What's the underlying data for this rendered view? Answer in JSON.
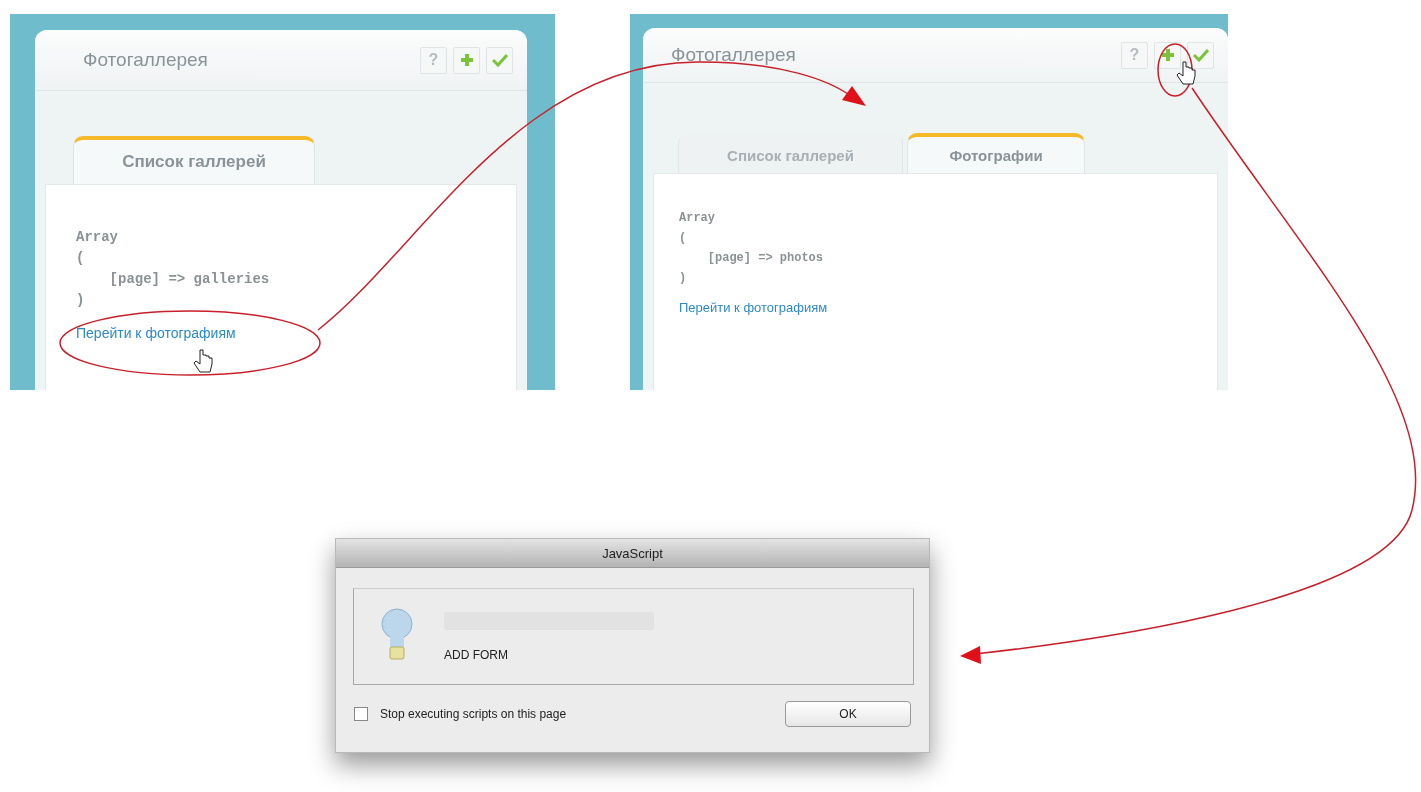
{
  "panels": [
    {
      "title": "Фотогаллерея",
      "buttons": [
        {
          "kind": "help",
          "label": "?"
        },
        {
          "kind": "add"
        },
        {
          "kind": "ok"
        }
      ],
      "tabs": [
        {
          "label": "Список галлерей",
          "selected": true
        }
      ],
      "code_lines": [
        "Array",
        "(",
        "    [page] => galleries",
        ")"
      ],
      "link": "Перейти к фотографиям"
    },
    {
      "title": "Фотогаллерея",
      "buttons": [
        {
          "kind": "help",
          "label": "?"
        },
        {
          "kind": "add"
        },
        {
          "kind": "ok"
        }
      ],
      "tabs": [
        {
          "label": "Список галлерей",
          "selected": false
        },
        {
          "label": "Фотографии",
          "selected": true
        }
      ],
      "code_lines": [
        "Array",
        "(",
        "    [page] => photos",
        ")"
      ],
      "link": "Перейти к фотографиям"
    }
  ],
  "dialog": {
    "title": "JavaScript",
    "message": "ADD FORM",
    "checkbox": {
      "label": "Stop executing scripts on this page",
      "checked": false
    },
    "button": "OK"
  }
}
